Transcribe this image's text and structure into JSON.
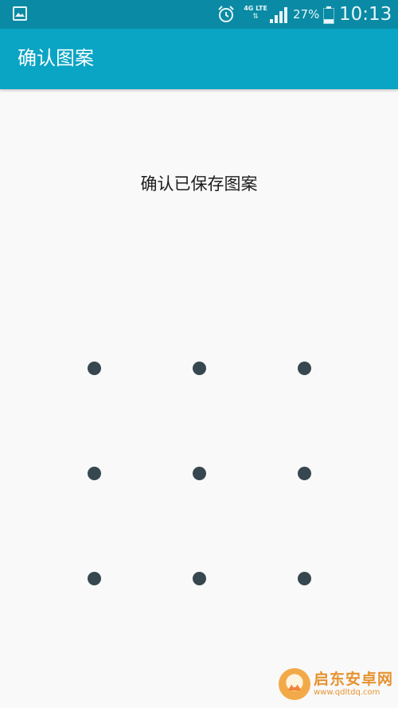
{
  "status_bar": {
    "network": "4G LTE",
    "network_arrows": "⇅",
    "battery_percent": "27%",
    "battery_level": 0.27,
    "time": "10:13"
  },
  "app_bar": {
    "title": "确认图案"
  },
  "prompt": "确认已保存图案",
  "pattern_grid": {
    "rows": 3,
    "cols": 3,
    "dot_color": "#37474f"
  },
  "watermark": {
    "name": "启东安卓网",
    "url": "www.qdltdq.com"
  },
  "colors": {
    "status_bar": "#0a8aa4",
    "app_bar": "#0aa4c4",
    "background": "#f9f9f9"
  }
}
